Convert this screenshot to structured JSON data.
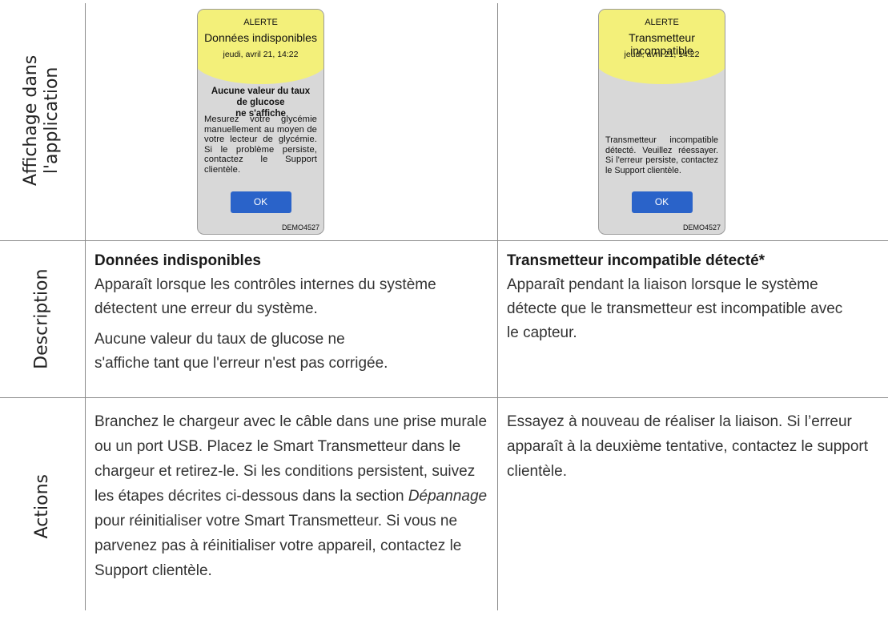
{
  "row_labels": {
    "app_display_line1": "Affichage dans",
    "app_display_line2": "l'application",
    "description": "Description",
    "actions": "Actions"
  },
  "screens": [
    {
      "alert": "ALERTE",
      "title": "Données indisponibles",
      "date": "jeudi, avril 21, 14:22",
      "heading_line1": "Aucune valeur du taux de glucose",
      "heading_line2": "ne s'affiche",
      "body": "Mesurez votre glycémie manuellement au moyen de votre lecteur de glycémie. Si le problème persiste, contactez le Support clientèle.",
      "ok": "OK",
      "demo": "DEMO4527"
    },
    {
      "alert": "ALERTE",
      "title": "Transmetteur incompatible",
      "date": "jeudi, avril 21, 14:22",
      "body": "Transmetteur incompatible détecté. Veuillez réessayer. Si l'erreur persiste, contactez le Support clientèle.",
      "ok": "OK",
      "demo": "DEMO4527"
    }
  ],
  "description": {
    "col1_heading": "Données indisponibles",
    "col1_para1": "Apparaît lorsque les contrôles internes du système détectent une erreur du système.",
    "col1_para2": "Aucune valeur du taux de glucose ne s'affiche tant que l'erreur n'est pas corrigée.",
    "col2_heading": "Transmetteur incompatible détecté*",
    "col2_para1": "Apparaît pendant la liaison lorsque le système détecte que le transmetteur est incompatible avec le capteur."
  },
  "actions": {
    "col1_text_before": "Branchez le chargeur avec le câble dans une prise murale ou un port USB. Placez le Smart Transmetteur dans le chargeur et retirez-le. Si les conditions persistent, suivez les étapes décrites ci-dessous dans la section ",
    "col1_italic": "Dépannage",
    "col1_text_after": " pour réinitialiser votre Smart Transmetteur. Si vous ne parvenez pas à réinitialiser votre appareil, contactez le Support clientèle.",
    "col2_text": "Essayez à nouveau de réaliser la liaison. Si l’erreur apparaît à la deuxième tentative, contactez le support clientèle."
  }
}
